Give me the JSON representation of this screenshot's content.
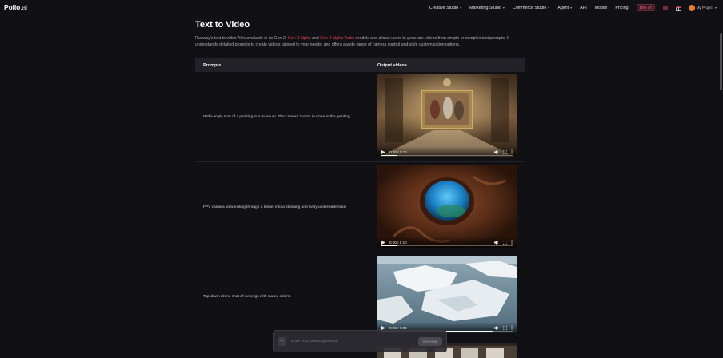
{
  "nav": {
    "logo_main": "Pollo",
    "logo_ai": ".ai",
    "items": [
      {
        "label": "Creative Studio",
        "dropdown": true
      },
      {
        "label": "Marketing Studio",
        "dropdown": true
      },
      {
        "label": "Commerce Studio",
        "dropdown": true
      },
      {
        "label": "Agent",
        "dropdown": true
      },
      {
        "label": "API",
        "dropdown": false
      },
      {
        "label": "Mobile",
        "dropdown": false
      },
      {
        "label": "Pricing",
        "dropdown": false
      }
    ],
    "credit_badge": "15% off",
    "project_label": "My Project",
    "accent": "#e9445e"
  },
  "main": {
    "title": "Text to Video",
    "desc_1": "Runway's text to video AI is available in its Gen-2, ",
    "desc_link_1": "Gen-3 Alpha",
    "desc_2": " and ",
    "desc_link_2": "Gen-3 Alpha Turbo",
    "desc_3": " models and allows users to generate videos from simple or complex text prompts. It understands detailed prompts to create videos tailored to your needs, and offers a wide range of camera control and style customization options."
  },
  "table": {
    "headers": [
      "Prompts",
      "Output videos"
    ],
    "rows": [
      {
        "prompt": "Wide-angle shot of a painting in a museum. The camera zooms in close to the painting.",
        "time": "0:00 / 0:10",
        "progress": 0.12
      },
      {
        "prompt": "FPV camera view exiting through a tunnel into a stunning and lively underwater lake.",
        "time": "0:00 / 0:10",
        "progress": 0.12
      },
      {
        "prompt": "Top-down drone shot of icebergs with muted colors.",
        "time": "0:00 / 0:04",
        "progress": 0.85
      },
      {
        "prompt": "",
        "time": "",
        "progress": 0
      }
    ]
  },
  "float_bar": {
    "placeholder": "Enter your idea to generate",
    "generate_label": "Generate"
  }
}
